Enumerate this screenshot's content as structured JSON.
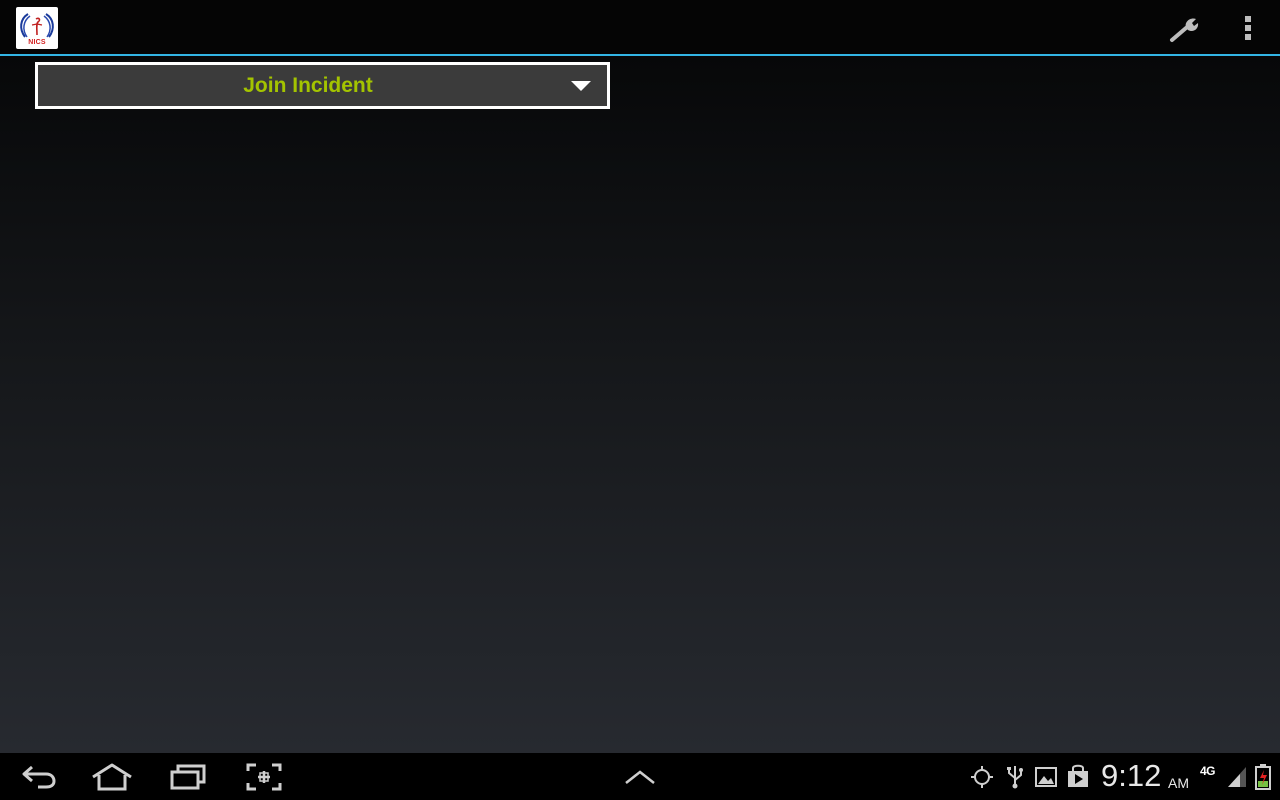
{
  "app": {
    "logo_text": "NICS",
    "logo_icon": "nics-logo-icon"
  },
  "action_bar": {
    "settings_icon": "wrench-icon",
    "overflow_icon": "overflow-menu-icon",
    "accent_color": "#33b5e5"
  },
  "main": {
    "incident_spinner": {
      "selected_value": "Join Incident",
      "text_color": "#a4c400",
      "arrow_icon": "dropdown-arrow-icon"
    }
  },
  "system_bar": {
    "nav": {
      "back_icon": "back-icon",
      "home_icon": "home-icon",
      "recents_icon": "recent-apps-icon",
      "screenshot_icon": "screenshot-icon",
      "menu_up_icon": "chevron-up-icon"
    },
    "status": {
      "gps_icon": "gps-icon",
      "usb_icon": "usb-icon",
      "gallery_icon": "image-icon",
      "store_icon": "play-store-icon",
      "time": "9:12",
      "ampm": "AM",
      "network": "4G",
      "signal_icon": "signal-icon",
      "battery_icon": "battery-icon"
    }
  }
}
